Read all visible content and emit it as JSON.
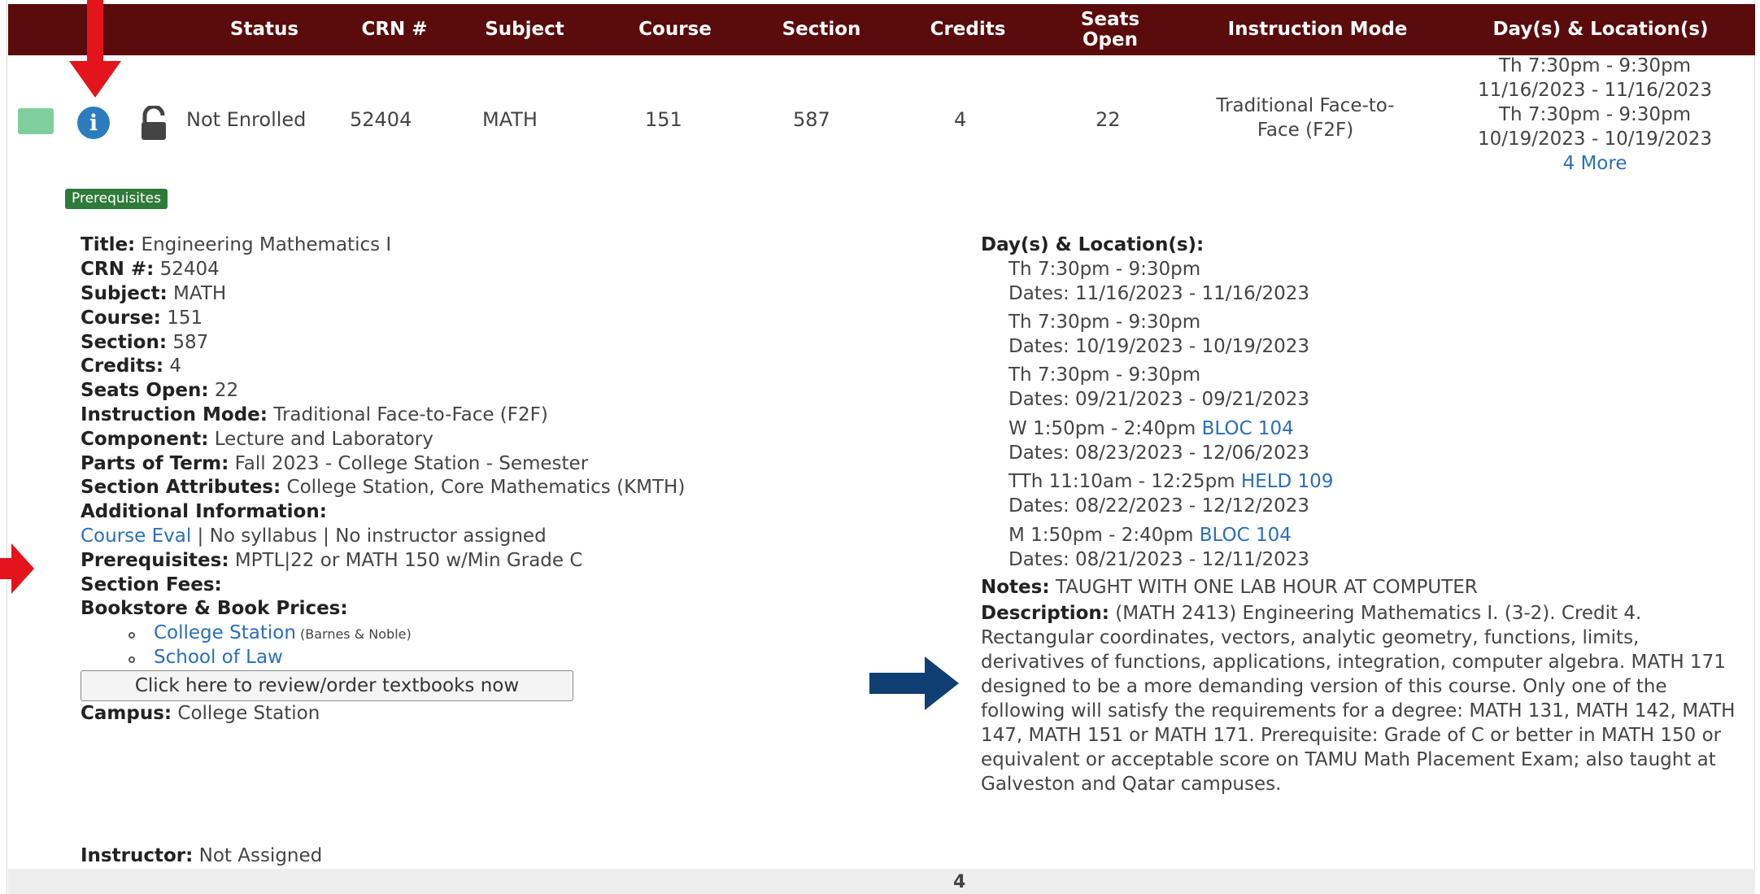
{
  "header": {
    "columns": [
      "Status",
      "CRN #",
      "Subject",
      "Course",
      "Section",
      "Credits",
      "Seats Open",
      "Instruction Mode",
      "Day(s) & Location(s)"
    ]
  },
  "row": {
    "status": "Not Enrolled",
    "crn": "52404",
    "subject": "MATH",
    "course": "151",
    "section": "587",
    "credits": "4",
    "seats_open": "22",
    "instruction_mode": "Traditional Face-to-Face (F2F)",
    "meetings": [
      {
        "time": "Th 7:30pm - 9:30pm",
        "dates": "11/16/2023 - 11/16/2023"
      },
      {
        "time": "Th 7:30pm - 9:30pm",
        "dates": "10/19/2023 - 10/19/2023"
      }
    ],
    "more_link": "4 More",
    "info_glyph": "i"
  },
  "badge": "Prerequisites",
  "details": {
    "title": {
      "label": "Title:",
      "value": " Engineering Mathematics I"
    },
    "crn": {
      "label": "CRN #:",
      "value": " 52404"
    },
    "subject": {
      "label": "Subject:",
      "value": " MATH"
    },
    "course": {
      "label": "Course:",
      "value": " 151"
    },
    "section": {
      "label": "Section:",
      "value": " 587"
    },
    "credits": {
      "label": "Credits:",
      "value": " 4"
    },
    "seats": {
      "label": "Seats Open:",
      "value": " 22"
    },
    "mode": {
      "label": "Instruction Mode:",
      "value": " Traditional Face-to-Face (F2F)"
    },
    "component": {
      "label": "Component:",
      "value": " Lecture and Laboratory"
    },
    "parts": {
      "label": "Parts of Term:",
      "value": " Fall 2023 - College Station - Semester"
    },
    "attributes": {
      "label": "Section Attributes:",
      "value": " College Station, Core Mathematics (KMTH)"
    },
    "additional": {
      "label": "Additional Information:"
    },
    "course_eval": "Course Eval",
    "no_syllabus": " | No syllabus | No instructor assigned",
    "prereq": {
      "label": "Prerequisites:",
      "value": " MPTL|22 or MATH 150 w/Min Grade C"
    },
    "fees": {
      "label": "Section Fees:"
    },
    "bookstore": {
      "label": "Bookstore & Book Prices:"
    },
    "store_college": "College Station",
    "store_college_note": " (Barnes & Noble)",
    "store_law": "School of Law",
    "textbook_button": "Click here to review/order textbooks now",
    "campus": {
      "label": "Campus:",
      "value": " College Station"
    },
    "instructor": {
      "label": "Instructor:",
      "value": " Not Assigned"
    }
  },
  "locations": {
    "label": "Day(s) & Location(s):",
    "entries": [
      {
        "time": "Th 7:30pm - 9:30pm",
        "room": "",
        "dates": "Dates: 11/16/2023 - 11/16/2023"
      },
      {
        "time": "Th 7:30pm - 9:30pm",
        "room": "",
        "dates": "Dates: 10/19/2023 - 10/19/2023"
      },
      {
        "time": "Th 7:30pm - 9:30pm",
        "room": "",
        "dates": "Dates: 09/21/2023 - 09/21/2023"
      },
      {
        "time": "W 1:50pm - 2:40pm ",
        "room": "BLOC 104",
        "dates": "Dates: 08/23/2023 - 12/06/2023"
      },
      {
        "time": "TTh 11:10am - 12:25pm ",
        "room": "HELD 109",
        "dates": "Dates: 08/22/2023 - 12/12/2023"
      },
      {
        "time": "M 1:50pm - 2:40pm ",
        "room": "BLOC 104",
        "dates": "Dates: 08/21/2023 - 12/11/2023"
      }
    ]
  },
  "notes": {
    "label": "Notes:",
    "value": " TAUGHT WITH ONE LAB HOUR AT COMPUTER"
  },
  "description": {
    "label": "Description:",
    "value": " (MATH 2413) Engineering Mathematics I. (3-2). Credit 4. Rectangular coordinates, vectors, analytic geometry, functions, limits, derivatives of functions, applications, integration, computer algebra. MATH 171 designed to be a more demanding version of this course. Only one of the following will satisfy the requirements for a degree: MATH 131, MATH 142, MATH 147, MATH 151 or MATH 171. Prerequisite: Grade of C or better in MATH 150 or equivalent or acceptable score on TAMU Math Placement Exam; also taught at Galveston and Qatar campuses."
  },
  "footer": {
    "count": "4"
  },
  "colors": {
    "header_bg": "#5a0b0b",
    "link": "#2a6ebb",
    "badge": "#2f7a3a",
    "arrow_red": "#e4141c",
    "arrow_blue": "#0f3e73",
    "status_green": "#7fcf9d"
  },
  "icons": [
    "info-icon",
    "unlock-icon",
    "red-arrow-down",
    "red-arrow-right",
    "blue-arrow-right"
  ]
}
